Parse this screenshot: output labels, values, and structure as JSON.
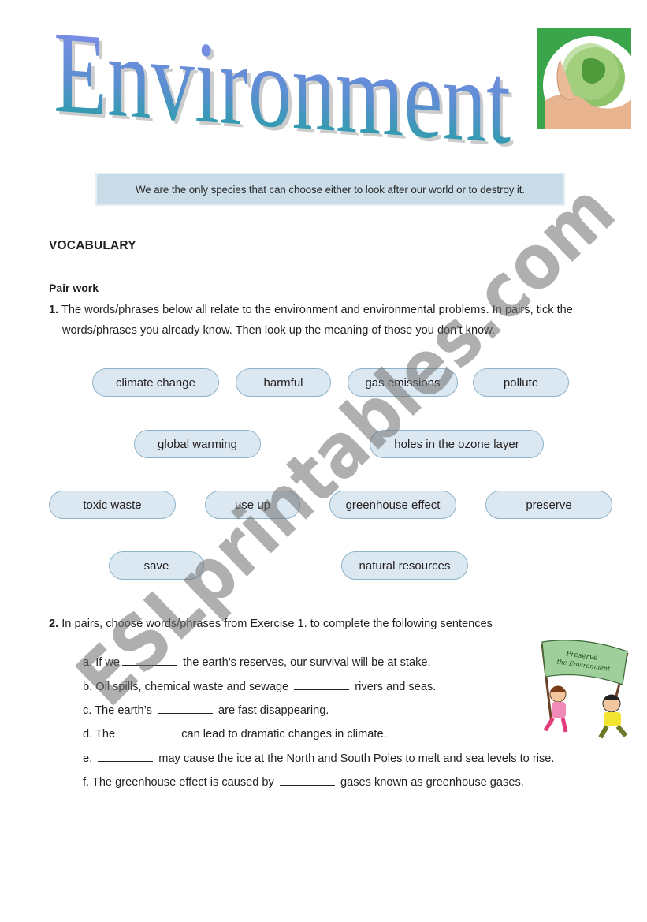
{
  "header": {
    "title": "Environment",
    "image_globe": "hands-holding-globe-image"
  },
  "quote": "We are the only species that can choose either to look after our world or to destroy it.",
  "section_heading": "VOCABULARY",
  "pair_work_label": "Pair work",
  "exercise1": {
    "number": "1.",
    "line1": "The words/phrases below all relate to the environment and environmental problems. In pairs, tick the",
    "line2": "words/phrases you already know. Then look up the meaning of those you don’t know."
  },
  "vocabulary": [
    "climate change",
    "harmful",
    "gas emissions",
    "pollute",
    "global warming",
    "holes in the ozone layer",
    "toxic waste",
    "use up",
    "greenhouse effect",
    "preserve",
    "save",
    "natural resources"
  ],
  "exercise2": {
    "number": "2.",
    "instruction": "In pairs, choose words/phrases from Exercise 1. to complete the following sentences",
    "sentences": [
      {
        "before": "a. If we",
        "after": " the earth’s reserves, our survival will be at stake."
      },
      {
        "before": "b. Oil spills, chemical waste and sewage ",
        "after": " rivers and seas."
      },
      {
        "before": "c. The earth’s ",
        "after": " are fast disappearing."
      },
      {
        "before": "d. The ",
        "after": " can lead to dramatic changes in climate."
      },
      {
        "before": "e. ",
        "after": " may cause the ice at the North and South Poles to melt and sea levels to rise."
      },
      {
        "before": "f.  The greenhouse effect is caused by ",
        "after": " gases known as greenhouse gases."
      }
    ]
  },
  "illustration": {
    "banner_line1": "Preserve",
    "banner_line2": "the Environment"
  },
  "watermark": "ESLprintables.com",
  "colors": {
    "pill_fill": "#dbe8f1",
    "pill_border": "#8fb3c8",
    "quote_bg": "#c9dce8",
    "title_top": "#8a8cf0",
    "title_bottom": "#1aa39a"
  }
}
